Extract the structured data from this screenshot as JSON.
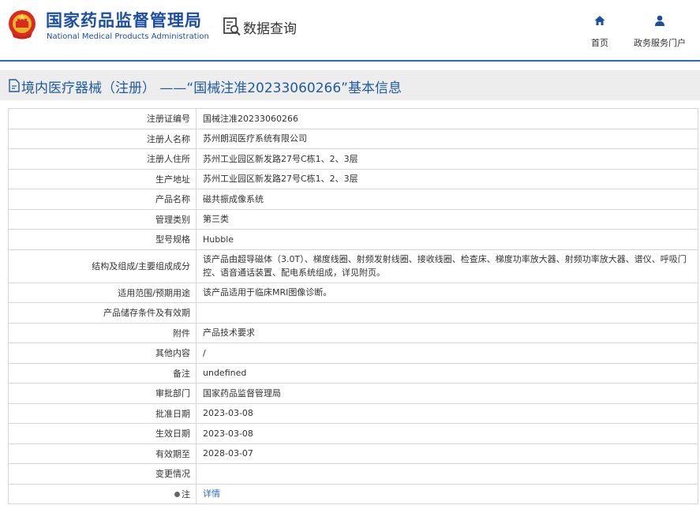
{
  "header": {
    "title_cn": "国家药品监督管理局",
    "title_en": "National Medical Products Administration",
    "data_query_label": "数据查询",
    "nav": {
      "home_label": "首页",
      "gov_service_label": "政务服务门户"
    }
  },
  "page": {
    "title": "境内医疗器械（注册） ——“国械注准20233060266”基本信息"
  },
  "fields": [
    {
      "label": "注册证编号",
      "value": "国械注准20233060266"
    },
    {
      "label": "注册人名称",
      "value": "苏州朗润医疗系统有限公司"
    },
    {
      "label": "注册人住所",
      "value": "苏州工业园区新发路27号C栋1、2、3层"
    },
    {
      "label": "生产地址",
      "value": "苏州工业园区新发路27号C栋1、2、3层"
    },
    {
      "label": "产品名称",
      "value": "磁共振成像系统"
    },
    {
      "label": "管理类别",
      "value": "第三类"
    },
    {
      "label": "型号规格",
      "value": "Hubble"
    },
    {
      "label": "结构及组成/主要组成成分",
      "value": "该产品由超导磁体（3.0T）、梯度线圈、射频发射线圈、接收线圈、检查床、梯度功率放大器、射频功率放大器、谱仪、呼吸门控、语音通话装置、配电系统组成，详见附页。"
    },
    {
      "label": "适用范围/预期用途",
      "value": "该产品适用于临床MRI图像诊断。"
    },
    {
      "label": "产品储存条件及有效期",
      "value": ""
    },
    {
      "label": "附件",
      "value": "产品技术要求"
    },
    {
      "label": "其他内容",
      "value": "/"
    },
    {
      "label": "备注",
      "value": "undefined"
    },
    {
      "label": "审批部门",
      "value": "国家药品监督管理局"
    },
    {
      "label": "批准日期",
      "value": "2023-03-08"
    },
    {
      "label": "生效日期",
      "value": "2023-03-08"
    },
    {
      "label": "有效期至",
      "value": "2028-03-07"
    },
    {
      "label": "变更情况",
      "value": ""
    },
    {
      "label": "注",
      "value": "详情"
    }
  ],
  "colors": {
    "brand_blue": "#1c4fa3",
    "header_line": "#2f6cb3",
    "link": "#2a6fc9"
  },
  "icons": {
    "emblem": "national-emblem-icon",
    "data_query": "document-search-icon",
    "home": "home-icon",
    "gov_service": "user-icon",
    "title": "document-edit-icon"
  }
}
